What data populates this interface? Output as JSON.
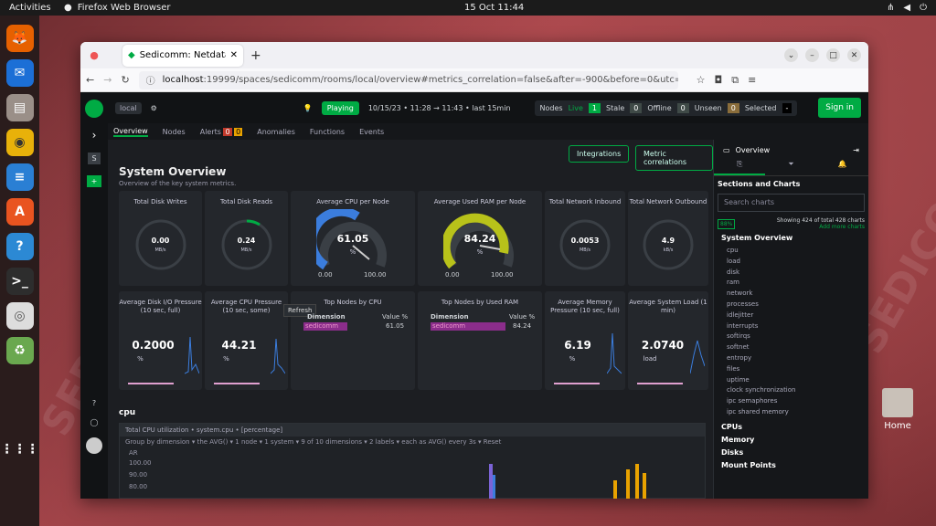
{
  "system": {
    "activities": "Activities",
    "app_name": "Firefox Web Browser",
    "clock": "15 Oct  11:44"
  },
  "desktop": {
    "home_label": "Home"
  },
  "browser": {
    "tab_title": "Sedicomm: Netdata Agen",
    "url_host": "localhost",
    "url_rest": ":19999/spaces/sedicomm/rooms/local/overview#metrics_correlation=false&after=-900&before=0&utc=undefined&of"
  },
  "netdata": {
    "space": "local",
    "playing": "Playing",
    "time_range": "10/15/23 • 11:28  →  11:43 • last  15min",
    "nodes_label": "Nodes",
    "live_label": "Live",
    "live": "1",
    "stale_label": "Stale",
    "stale": "0",
    "offline_label": "Offline",
    "offline": "0",
    "unseen_label": "Unseen",
    "unseen": "0",
    "selected_label": "Selected",
    "selected": "-",
    "signin": "Sign in",
    "tabs": [
      "Overview",
      "Nodes",
      "Alerts",
      "Anomalies",
      "Functions",
      "Events"
    ],
    "alerts_counts": [
      "0",
      "0"
    ],
    "integrations": "Integrations",
    "metric_correlations": "Metric correlations",
    "title": "System Overview",
    "subtitle": "Overview of the key system metrics.",
    "refresh_tooltip": "Refresh",
    "cards_row1": [
      {
        "title": "Total Disk Writes",
        "value": "0.00",
        "unit": "MB/s"
      },
      {
        "title": "Total Disk Reads",
        "value": "0.24",
        "unit": "MB/s"
      },
      {
        "title": "Average CPU per Node",
        "value": "61.05",
        "unit": "%",
        "min": "0.00",
        "max": "100.00"
      },
      {
        "title": "Average Used RAM per Node",
        "value": "84.24",
        "unit": "%",
        "min": "0.00",
        "max": "100.00"
      },
      {
        "title": "Total Network Inbound",
        "value": "0.0053",
        "unit": "MB/s"
      },
      {
        "title": "Total Network Outbound",
        "value": "4.9",
        "unit": "kB/s"
      }
    ],
    "cards_row2": [
      {
        "title": "Average Disk I/O Pressure (10 sec, full)",
        "value": "0.2000",
        "unit": "%"
      },
      {
        "title": "Average CPU Pressure (10 sec, some)",
        "value": "44.21",
        "unit": "%"
      },
      {
        "title": "Top Nodes by CPU",
        "dim_label": "Dimension",
        "val_label": "Value %",
        "node": "sedicomm",
        "node_value": "61.05"
      },
      {
        "title": "Top Nodes by Used RAM",
        "dim_label": "Dimension",
        "val_label": "Value %",
        "node": "sedicomm",
        "node_value": "84.24"
      },
      {
        "title": "Average Memory Pressure (10 sec, full)",
        "value": "6.19",
        "unit": "%"
      },
      {
        "title": "Average System Load (1 min)",
        "value": "2.0740",
        "unit": "load"
      }
    ],
    "section_cpu": "cpu",
    "chart_title": "Total CPU utilization  • system.cpu • [percentage]",
    "chart_controls": "Group by  dimension ▾  the  AVG() ▾  1 node ▾  1 system ▾  9 of 10 dimensions ▾  2 labels ▾  each as  AVG() every 3s ▾   Reset",
    "y_labels": [
      "AR",
      "100.00",
      "90.00",
      "80.00"
    ],
    "right_panel": {
      "title": "Overview",
      "sections_label": "Sections and Charts",
      "search_placeholder": "Search charts",
      "percent": "88%",
      "showing": "Showing 424 of total 428 charts",
      "add_more": "Add more charts",
      "heading": "System Overview",
      "items": [
        "cpu",
        "load",
        "disk",
        "ram",
        "network",
        "processes",
        "idlejitter",
        "interrupts",
        "softirqs",
        "softnet",
        "entropy",
        "files",
        "uptime",
        "clock synchronization",
        "ipc semaphores",
        "ipc shared memory"
      ],
      "groups": [
        "CPUs",
        "Memory",
        "Disks",
        "Mount Points"
      ]
    }
  }
}
